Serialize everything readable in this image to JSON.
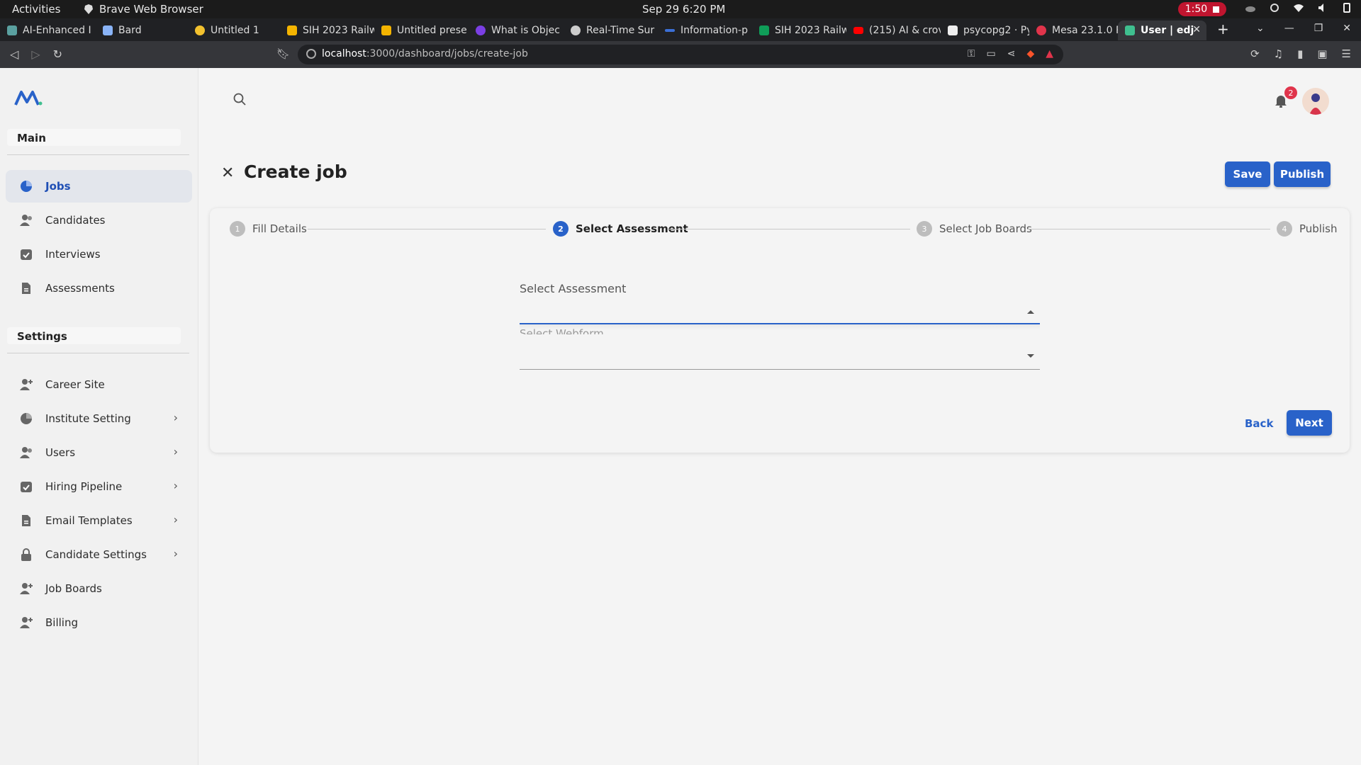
{
  "os": {
    "activities": "Activities",
    "app_name": "Brave Web Browser",
    "clock": "Sep 29  6:20 PM",
    "recording": "1:50"
  },
  "browser": {
    "tabs": [
      {
        "label": "AI-Enhanced I",
        "color": "#5aa0a0"
      },
      {
        "label": "Bard",
        "color": "#8ab4f8"
      },
      {
        "label": "Untitled 1",
        "color": "#f2c12e"
      },
      {
        "label": "SIH 2023 Railw",
        "color": "#f4b400"
      },
      {
        "label": "Untitled prese",
        "color": "#f4b400"
      },
      {
        "label": "What is Objec",
        "color": "#7b3fe4"
      },
      {
        "label": "Real-Time Sur",
        "color": "#cccccc"
      },
      {
        "label": "Information-p",
        "color": "#3b6fd6"
      },
      {
        "label": "SIH 2023 Railw",
        "color": "#0f9d58"
      },
      {
        "label": "(215) AI & crov",
        "color": "#ff0000"
      },
      {
        "label": "psycopg2 · Py",
        "color": "#eeeeee"
      },
      {
        "label": "Mesa 23.1.0 R",
        "color": "#e0344b"
      },
      {
        "label": "User | edj",
        "color": "#3fbf8f"
      }
    ],
    "url_host": "localhost",
    "url_path": ":3000/dashboard/jobs/create-job"
  },
  "sidebar": {
    "main_label": "Main",
    "settings_label": "Settings",
    "main_items": [
      {
        "label": "Jobs",
        "icon": "pie-chart-icon"
      },
      {
        "label": "Candidates",
        "icon": "users-icon"
      },
      {
        "label": "Interviews",
        "icon": "calendar-check-icon"
      },
      {
        "label": "Assessments",
        "icon": "document-icon"
      }
    ],
    "settings_items": [
      {
        "label": "Career Site",
        "icon": "user-add-icon"
      },
      {
        "label": "Institute Setting",
        "icon": "pie-chart-icon"
      },
      {
        "label": "Users",
        "icon": "users-icon"
      },
      {
        "label": "Hiring Pipeline",
        "icon": "calendar-check-icon"
      },
      {
        "label": "Email Templates",
        "icon": "document-icon"
      },
      {
        "label": "Candidate Settings",
        "icon": "lock-icon"
      },
      {
        "label": "Job Boards",
        "icon": "user-add-icon"
      },
      {
        "label": "Billing",
        "icon": "user-add-icon"
      }
    ]
  },
  "header": {
    "notification_count": "2"
  },
  "page": {
    "title": "Create job",
    "save_label": "Save",
    "publish_label": "Publish",
    "steps": [
      {
        "num": "1",
        "label": "Fill Details"
      },
      {
        "num": "2",
        "label": "Select Assessment"
      },
      {
        "num": "3",
        "label": "Select Job Boards"
      },
      {
        "num": "4",
        "label": "Publish"
      }
    ],
    "active_step": 2,
    "select_assessment_label": "Select Assessment",
    "select_assessment_value": "",
    "select_webform_label": "Select Webform",
    "back_label": "Back",
    "next_label": "Next",
    "accent": "#2962c9"
  }
}
